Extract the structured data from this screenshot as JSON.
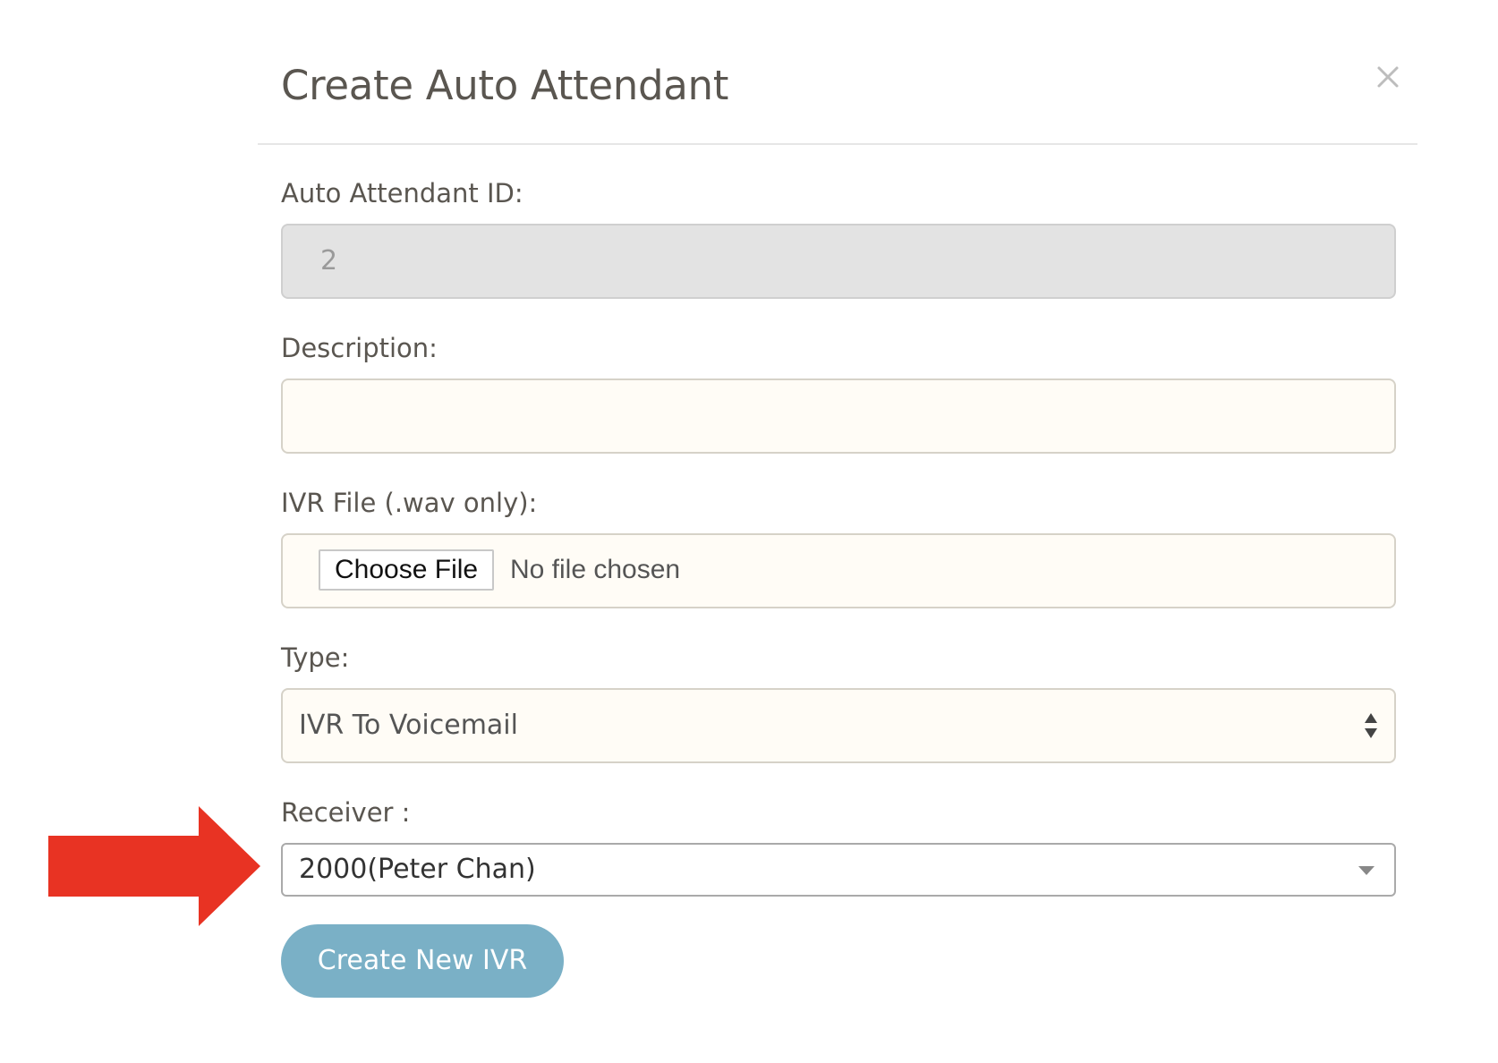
{
  "modal": {
    "title": "Create Auto Attendant",
    "close_icon": "close-icon"
  },
  "form": {
    "id_field": {
      "label": "Auto Attendant ID:",
      "value": "2"
    },
    "description_field": {
      "label": "Description:",
      "value": ""
    },
    "ivr_file_field": {
      "label": "IVR File (.wav only):",
      "button_label": "Choose File",
      "status_text": "No file chosen"
    },
    "type_field": {
      "label": "Type:",
      "selected": "IVR To Voicemail",
      "icon": "updown-arrows-icon"
    },
    "receiver_field": {
      "label": "Receiver :",
      "selected": "2000(Peter Chan)",
      "icon": "caret-down-icon"
    },
    "submit_label": "Create New IVR"
  },
  "annotation": {
    "icon": "red-arrow-icon",
    "color": "#e83323"
  },
  "colors": {
    "button": "#7ab0c6",
    "title": "#5a5650",
    "input_bg": "#fffcf6",
    "disabled_bg": "#e3e3e3"
  }
}
